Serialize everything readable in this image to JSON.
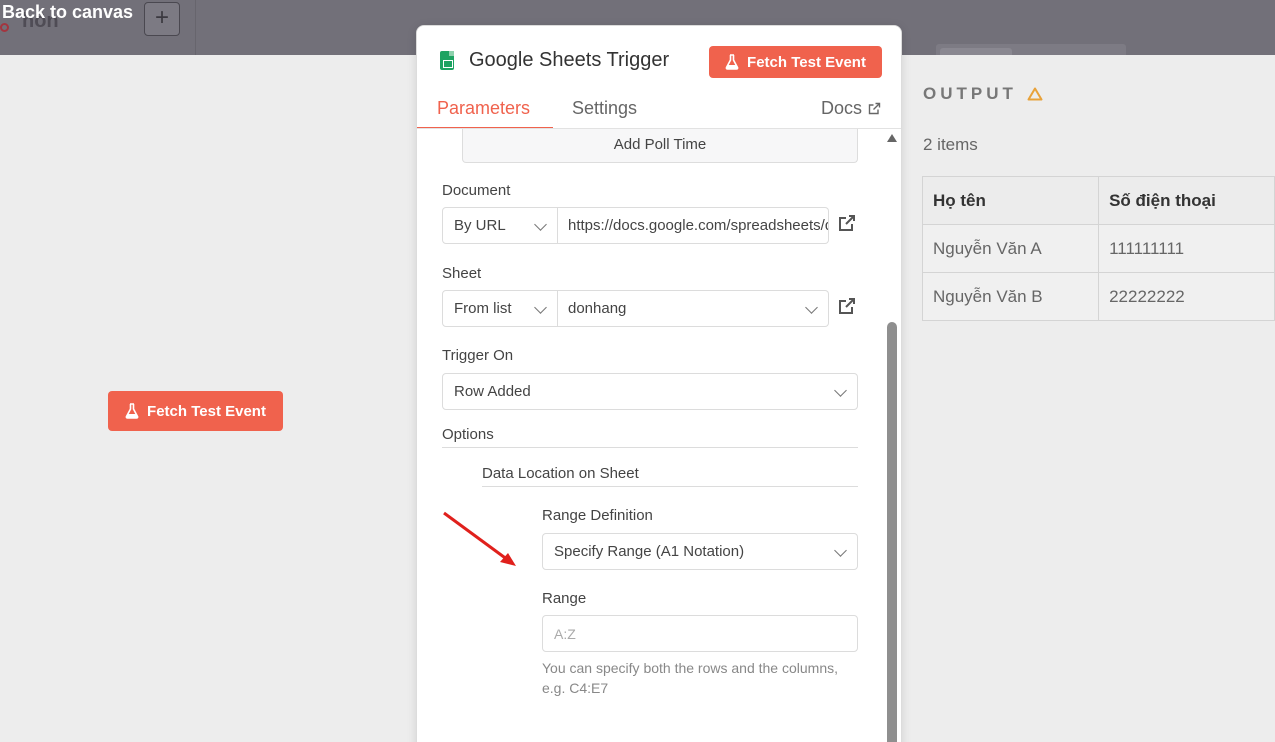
{
  "canvas": {
    "back_label": "Back to canvas",
    "ghost_node_name": "hôn",
    "add_label": "+",
    "fetch_label": "Fetch Test Event"
  },
  "panel": {
    "title": "Google Sheets Trigger",
    "fetch_label": "Fetch Test Event",
    "tabs": {
      "parameters": "Parameters",
      "settings": "Settings",
      "docs": "Docs"
    },
    "poll_button": "Add Poll Time",
    "document": {
      "label": "Document",
      "mode": "By URL",
      "value": "https://docs.google.com/spreadsheets/d/"
    },
    "sheet": {
      "label": "Sheet",
      "mode": "From list",
      "value": "donhang"
    },
    "trigger_on": {
      "label": "Trigger On",
      "value": "Row Added"
    },
    "options_label": "Options",
    "data_location_label": "Data Location on Sheet",
    "range_definition": {
      "label": "Range Definition",
      "value": "Specify Range (A1 Notation)"
    },
    "range": {
      "label": "Range",
      "placeholder": "A:Z",
      "hint": "You can specify both the rows and the columns, e.g. C4:E7"
    }
  },
  "output": {
    "title": "OUTPUT",
    "items_count": "2 items",
    "columns": [
      "Họ tên",
      "Số điện thoại"
    ],
    "rows": [
      [
        "Nguyễn Văn A",
        "111111111"
      ],
      [
        "Nguyễn Văn B",
        "22222222"
      ]
    ]
  },
  "colors": {
    "accent": "#f0624d",
    "sheets_green": "#1ea362",
    "warning": "#e8a23a",
    "annotation_arrow": "#e0201c"
  }
}
